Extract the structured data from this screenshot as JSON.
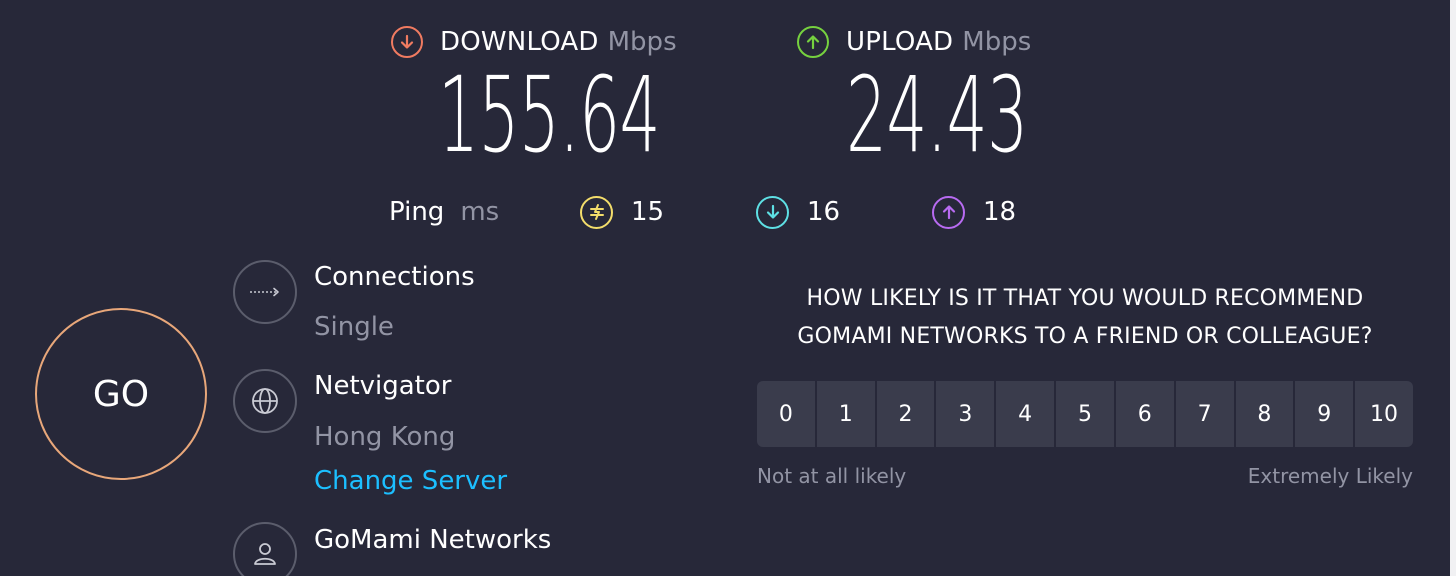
{
  "download": {
    "label": "DOWNLOAD",
    "unit": "Mbps",
    "value": "155.64",
    "icon": "arrow-down-circle-icon",
    "color": "#f07b61"
  },
  "upload": {
    "label": "UPLOAD",
    "unit": "Mbps",
    "value": "24.43",
    "icon": "arrow-up-circle-icon",
    "color": "#76d13f"
  },
  "ping": {
    "label": "Ping",
    "unit": "ms",
    "items": [
      {
        "icon": "jitter-icon",
        "value": "15",
        "color": "#f3dd6b"
      },
      {
        "icon": "download-latency-icon",
        "value": "16",
        "color": "#5ee0e4"
      },
      {
        "icon": "upload-latency-icon",
        "value": "18",
        "color": "#b86bf2"
      }
    ]
  },
  "go_button": {
    "label": "GO",
    "color": "#e8a77a"
  },
  "connections": {
    "title": "Connections",
    "value": "Single",
    "icon": "connections-arrow-icon"
  },
  "server": {
    "title": "Netvigator",
    "location": "Hong Kong",
    "change_link": "Change Server",
    "icon": "globe-icon"
  },
  "provider": {
    "title": "GoMami Networks",
    "icon": "user-icon"
  },
  "survey": {
    "question_line1": "HOW LIKELY IS IT THAT YOU WOULD RECOMMEND",
    "question_line2": "GOMAMI NETWORKS TO A FRIEND OR COLLEAGUE?",
    "options": [
      "0",
      "1",
      "2",
      "3",
      "4",
      "5",
      "6",
      "7",
      "8",
      "9",
      "10"
    ],
    "low_label": "Not at all likely",
    "high_label": "Extremely Likely"
  }
}
